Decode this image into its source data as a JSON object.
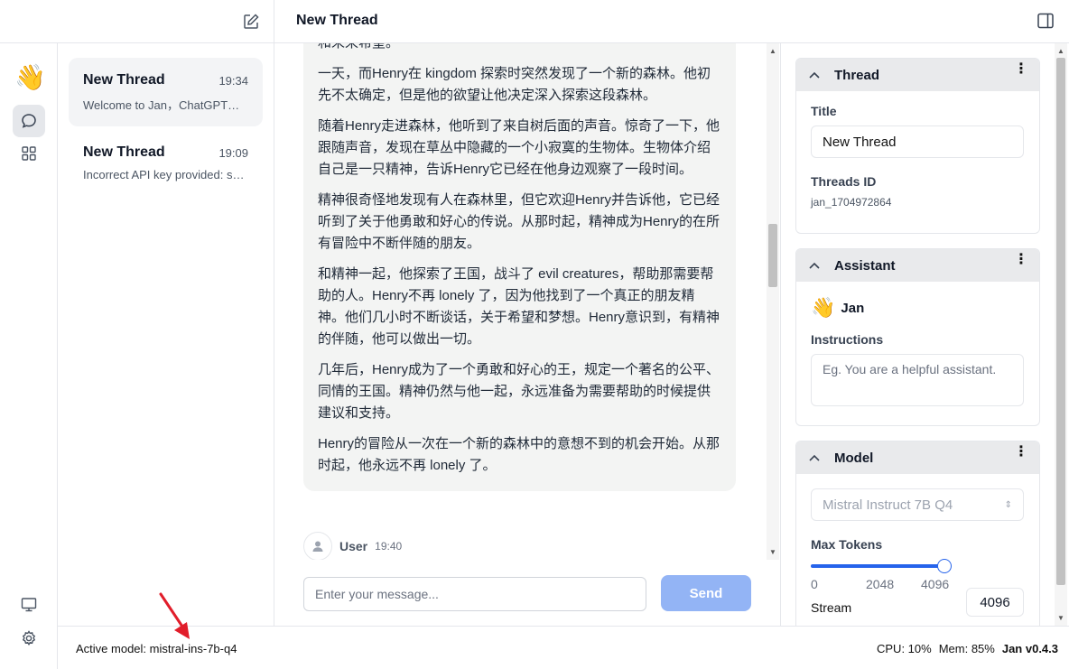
{
  "header": {
    "thread_title": "New Thread"
  },
  "rail": {
    "logo_emoji": "👋",
    "items": [
      {
        "name": "chat",
        "icon": "chat-bubble-icon",
        "active": true
      },
      {
        "name": "hub",
        "icon": "grid-icon",
        "active": false
      },
      {
        "name": "system-monitor",
        "icon": "monitor-icon",
        "active": false
      },
      {
        "name": "settings",
        "icon": "gear-icon",
        "active": false
      }
    ]
  },
  "threads": [
    {
      "title": "New Thread",
      "time": "19:34",
      "preview": "Welcome to Jan，ChatGPT的替代品…",
      "active": true
    },
    {
      "title": "New Thread",
      "time": "19:09",
      "preview": "Incorrect API key provided: sk-…",
      "active": false
    }
  ],
  "message": {
    "first_line": "和未来希望。",
    "paragraphs": [
      "一天，而Henry在 kingdom 探索时突然发现了一个新的森林。他初先不太确定，但是他的欲望让他决定深入探索这段森林。",
      "随着Henry走进森林，他听到了来自树后面的声音。惊奇了一下，他跟随声音，发现在草丛中隐藏的一个小寂寞的生物体。生物体介绍自己是一只精神，告诉Henry它已经在他身边观察了一段时间。",
      "精神很奇怪地发现有人在森林里，但它欢迎Henry并告诉他，它已经听到了关于他勇敢和好心的传说。从那时起，精神成为Henry的在所有冒险中不断伴随的朋友。",
      "和精神一起，他探索了王国，战斗了 evil creatures，帮助那需要帮助的人。Henry不再 lonely 了，因为他找到了一个真正的朋友精神。他们几小时不断谈话，关于希望和梦想。Henry意识到，有精神的伴随，他可以做出一切。",
      "几年后，Henry成为了一个勇敢和好心的王，规定一个著名的公平、同情的王国。精神仍然与他一起，永远准备为需要帮助的时候提供建议和支持。",
      "Henry的冒险从一次在一个新的森林中的意想不到的机会开始。从那时起，他永远不再 lonely 了。"
    ]
  },
  "user_row": {
    "name": "User",
    "time": "19:40"
  },
  "composer": {
    "placeholder": "Enter your message...",
    "send_label": "Send"
  },
  "right_panel": {
    "thread_card": {
      "title": "Thread",
      "title_label": "Title",
      "title_value": "New Thread",
      "id_label": "Threads ID",
      "id_value": "jan_1704972864"
    },
    "assistant_card": {
      "title": "Assistant",
      "emoji": "👋",
      "name": "Jan",
      "instructions_label": "Instructions",
      "instructions_placeholder": "Eg. You are a helpful assistant."
    },
    "model_card": {
      "title": "Model",
      "model_select": "Mistral Instruct 7B Q4",
      "max_tokens_label": "Max Tokens",
      "max_tokens_value": "4096",
      "slider_min": "0",
      "slider_mid": "2048",
      "slider_max": "4096",
      "slider_level": 1.0,
      "stream_label": "Stream",
      "stream_on": true
    }
  },
  "status_bar": {
    "active_model": "Active model: mistral-ins-7b-q4",
    "cpu": "CPU: 10%",
    "mem": "Mem: 85%",
    "version": "Jan v0.4.3"
  },
  "colors": {
    "accent": "#2563eb",
    "send_disabled": "#93b4f5",
    "annotation_arrow": "#e11d2a"
  }
}
